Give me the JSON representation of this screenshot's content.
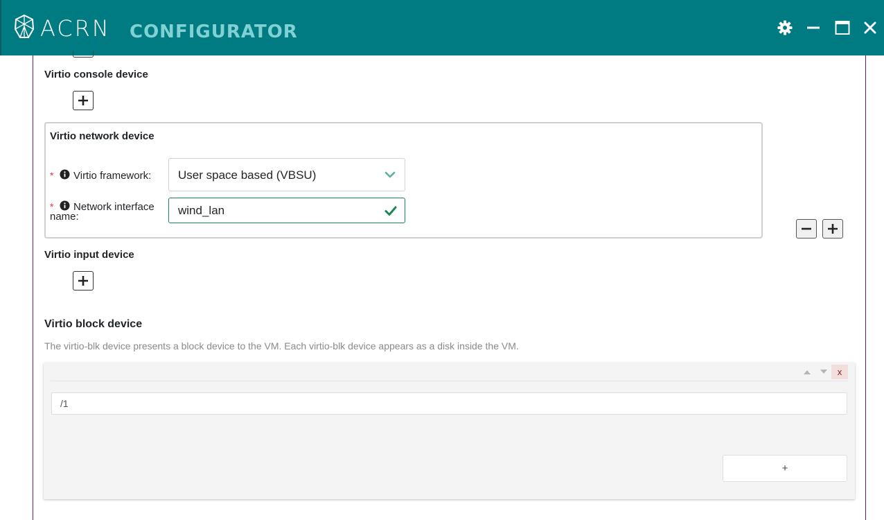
{
  "window": {
    "brand": "ACRN",
    "subtitle": "CONFIGURATOR",
    "icons": [
      "gear-icon",
      "minimize-icon",
      "maximize-icon",
      "close-icon"
    ],
    "colors": {
      "titlebar": "#007b82",
      "subtitle": "#7fd1d4",
      "frame_border": "#6a1b6e"
    }
  },
  "console_device": {
    "label": "Virtio console device",
    "add_icon": "plus-icon"
  },
  "network_device": {
    "label": "Virtio network device",
    "required_mark": "*",
    "framework": {
      "label": "Virtio framework:",
      "value": "User space based (VBSU)",
      "icon": "chevron-down-icon"
    },
    "interface": {
      "label": "Network interface name:",
      "value": "wind_lan",
      "icon": "check-icon",
      "valid_color": "#198754"
    },
    "remove_icon": "minus-icon",
    "add_icon": "plus-icon"
  },
  "input_device": {
    "label": "Virtio input device",
    "add_icon": "plus-icon"
  },
  "block_device": {
    "title": "Virtio block device",
    "description": "The virtio-blk device presents a block device to the VM. Each virtio-blk device appears as a disk inside the VM.",
    "item_value": "/1",
    "remove_label": "x",
    "add_label": "+"
  }
}
